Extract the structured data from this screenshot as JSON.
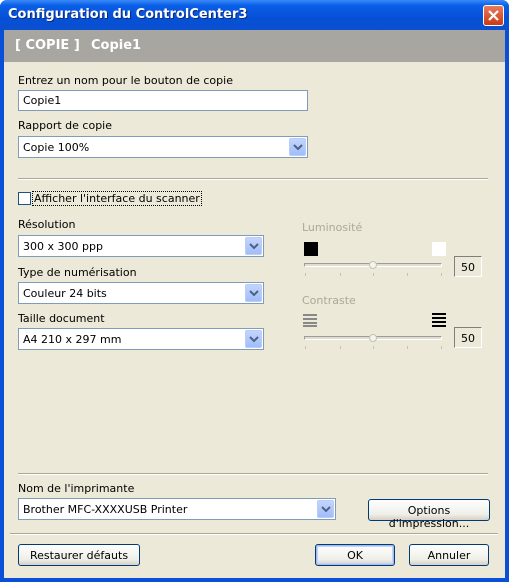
{
  "window": {
    "title": "Configuration du ControlCenter3"
  },
  "header": {
    "tag": "[ COPIE ]",
    "name": "Copie1"
  },
  "copy_name": {
    "label": "Entrez un nom pour le bouton de copie",
    "value": "Copie1"
  },
  "copy_ratio": {
    "label": "Rapport de copie",
    "value": "Copie 100%"
  },
  "scanner_ui": {
    "label": "Afficher l'interface du scanner",
    "checked": false
  },
  "resolution": {
    "label": "Résolution",
    "value": "300 x 300 ppp"
  },
  "scan_type": {
    "label": "Type de numérisation",
    "value": "Couleur 24 bits"
  },
  "doc_size": {
    "label": "Taille document",
    "value": "A4 210 x 297 mm"
  },
  "brightness": {
    "label": "Luminosité",
    "value": "50",
    "level": 50
  },
  "contrast": {
    "label": "Contraste",
    "value": "50",
    "level": 50
  },
  "printer": {
    "label": "Nom de l'imprimante",
    "value": "Brother MFC-XXXXUSB Printer",
    "options_button": "Options d'impression..."
  },
  "buttons": {
    "restore": "Restaurer défauts",
    "ok": "OK",
    "cancel": "Annuler"
  },
  "colors": {
    "titlebar": "#0a5fe8",
    "header_bar": "#a7a6a1",
    "dialog_bg": "#ece9d8",
    "close": "#c93a14"
  }
}
